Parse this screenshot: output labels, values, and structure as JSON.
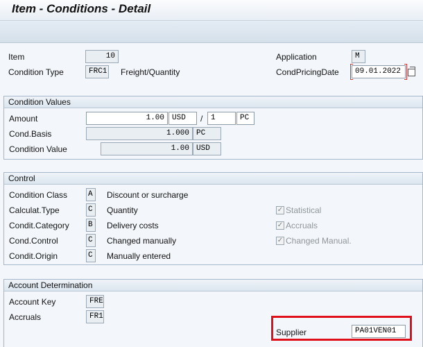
{
  "window": {
    "title": "Item - Conditions - Detail"
  },
  "header": {
    "item_label": "Item",
    "item_value": "10",
    "condition_type_label": "Condition Type",
    "condition_type_value": "FRC1",
    "condition_type_text": "Freight/Quantity",
    "application_label": "Application",
    "application_value": "M",
    "pricing_date_label": "CondPricingDate",
    "pricing_date_value": "09.01.2022"
  },
  "condition_values": {
    "title": "Condition Values",
    "amount_label": "Amount",
    "amount_value": "1.00",
    "amount_currency": "USD",
    "slash": "/",
    "per_value": "1",
    "per_unit": "PC",
    "cond_basis_label": "Cond.Basis",
    "cond_basis_value": "1.000",
    "cond_basis_unit": "PC",
    "condition_value_label": "Condition Value",
    "condition_value_value": "1.00",
    "condition_value_currency": "USD"
  },
  "control": {
    "title": "Control",
    "rows": [
      {
        "label": "Condition Class",
        "code": "A",
        "text": "Discount or surcharge"
      },
      {
        "label": "Calculat.Type",
        "code": "C",
        "text": "Quantity"
      },
      {
        "label": "Condit.Category",
        "code": "B",
        "text": "Delivery costs"
      },
      {
        "label": "Cond.Control",
        "code": "C",
        "text": "Changed manually"
      },
      {
        "label": "Condit.Origin",
        "code": "C",
        "text": "Manually entered"
      }
    ],
    "checkboxes": [
      {
        "label": "Statistical",
        "checked": true
      },
      {
        "label": "Accruals",
        "checked": true
      },
      {
        "label": "Changed Manual.",
        "checked": true
      }
    ]
  },
  "account_determination": {
    "title": "Account Determination",
    "account_key_label": "Account Key",
    "account_key_value": "FRE",
    "accruals_label": "Accruals",
    "accruals_value": "FR1",
    "supplier_label": "Supplier",
    "supplier_value": "PA01VEN01"
  },
  "colors": {
    "highlight": "#e0101a",
    "group_border": "#a5b7c9",
    "background": "#f3f7fb"
  }
}
